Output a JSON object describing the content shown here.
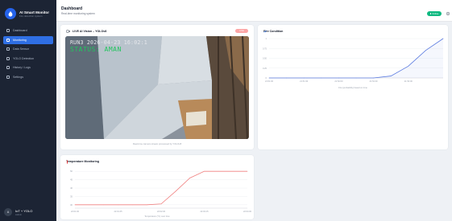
{
  "brand": {
    "title": "AI Smart Monitor",
    "subtitle": "Fire detection system"
  },
  "sidebar": {
    "items": [
      {
        "label": "Dashboard",
        "active": false
      },
      {
        "label": "Monitoring",
        "active": true
      },
      {
        "label": "Data Sensor",
        "active": false
      },
      {
        "label": "YOLO Detection",
        "active": false
      },
      {
        "label": "History / Logs",
        "active": false
      },
      {
        "label": "Settings",
        "active": false
      }
    ]
  },
  "user": {
    "initials": "A",
    "name": "IoT + YOLO",
    "role": "Admin"
  },
  "header": {
    "title": "Dashboard",
    "subtitle": "Real-time monitoring system",
    "status": "Online"
  },
  "camera": {
    "title": "LIVE AI Vision – YOLOv8",
    "badge": "LIVE",
    "timestamp": "RUN3 2026-04-23 16:02:1",
    "status": "STATUS: AMAN",
    "caption": "Real-time camera stream processed by YOLOv8"
  },
  "fire_panel": {
    "title": "Fire Condition",
    "xcaption": "Fire (probability) based on time"
  },
  "temp_panel": {
    "title": "Temperature Monitoring",
    "xcaption": "Temperature (°C) over time"
  },
  "colors": {
    "accent": "#2f6fe4",
    "online": "#10b981",
    "fire_line": "#5b7be0",
    "temp_line": "#f08080",
    "sidebar_bg": "#1c2434"
  },
  "chart_data": [
    {
      "type": "line",
      "title": "Fire Condition",
      "x": [
        "21:51:00",
        "21:51:15",
        "21:51:30",
        "21:51:45",
        "21:52:00",
        "21:52:15",
        "21:52:30",
        "21:52:45",
        "21:53:00",
        "21:53:15",
        "21:53:30"
      ],
      "xticks": [
        "21:51:00",
        "21:51:30",
        "21:52:00",
        "21:52:30",
        "21:53:00"
      ],
      "series": [
        {
          "values": [
            0,
            0,
            0,
            0,
            0,
            0,
            0,
            0.05,
            0.3,
            0.7,
            1.0
          ]
        }
      ],
      "yticks": [
        "0",
        "0.25",
        "0.50",
        "0.75",
        "1"
      ],
      "ylim": [
        0,
        1
      ],
      "grid": true
    },
    {
      "type": "line",
      "title": "Temperature Monitoring",
      "x": [
        "22:01:00",
        "22:01:15",
        "22:01:30",
        "22:01:45",
        "22:02:00",
        "22:02:15",
        "22:02:30",
        "22:02:45",
        "22:03:00",
        "22:03:15",
        "22:03:30",
        "22:03:45",
        "22:04:00"
      ],
      "xticks": [
        "22:01:00",
        "22:01:45",
        "22:02:30",
        "22:03:15",
        "22:04:00"
      ],
      "series": [
        {
          "values": [
            30,
            30,
            30,
            30,
            30,
            30,
            30.5,
            38,
            46,
            50,
            50,
            50,
            50
          ]
        }
      ],
      "yticks": [
        "30",
        "35",
        "40",
        "45",
        "50"
      ],
      "ylim": [
        28,
        52
      ],
      "grid": true
    }
  ]
}
